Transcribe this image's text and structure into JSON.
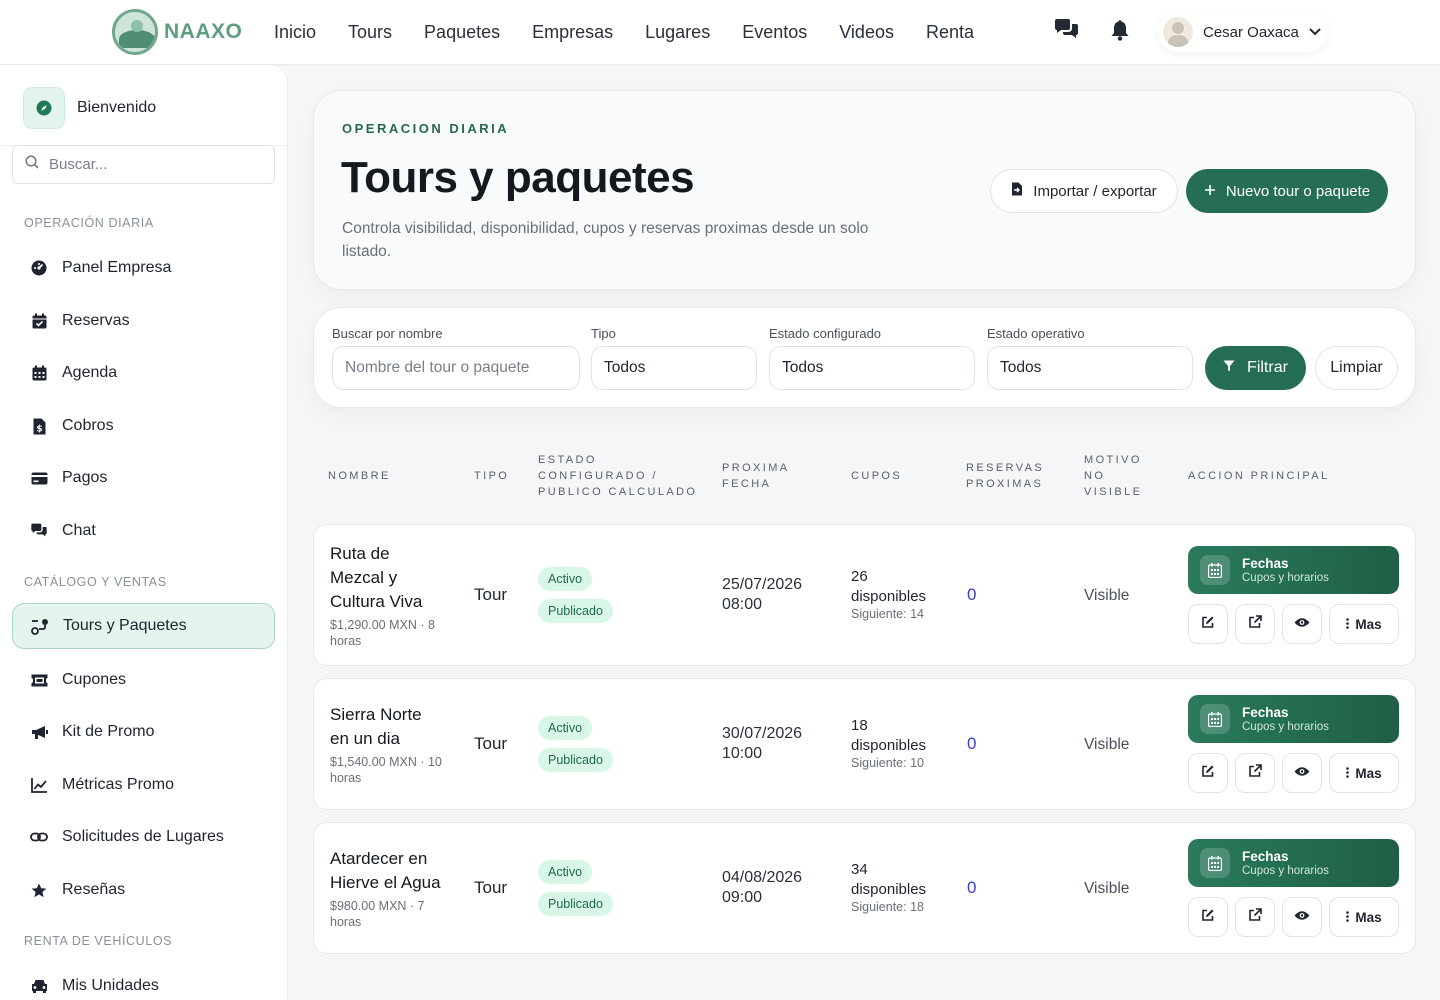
{
  "brand": {
    "name": "NAAXO"
  },
  "nav": [
    "Inicio",
    "Tours",
    "Paquetes",
    "Empresas",
    "Lugares",
    "Eventos",
    "Videos",
    "Renta"
  ],
  "user": {
    "name": "Cesar Oaxaca"
  },
  "sidebar": {
    "welcome": "Bienvenido",
    "search_placeholder": "Buscar...",
    "sections": [
      "OPERACIÓN DIARIA",
      "CATÁLOGO Y VENTAS",
      "RENTA DE VEHÍCULOS"
    ],
    "items": [
      {
        "label": "Panel Empresa",
        "icon": "dashboard-icon"
      },
      {
        "label": "Reservas",
        "icon": "calendar-check-icon"
      },
      {
        "label": "Agenda",
        "icon": "calendar-icon"
      },
      {
        "label": "Cobros",
        "icon": "invoice-dollar-icon"
      },
      {
        "label": "Pagos",
        "icon": "credit-card-icon"
      },
      {
        "label": "Chat",
        "icon": "chat-icon"
      },
      {
        "label": "Tours y Paquetes",
        "icon": "route-icon",
        "active": true
      },
      {
        "label": "Cupones",
        "icon": "ticket-icon"
      },
      {
        "label": "Kit de Promo",
        "icon": "megaphone-icon"
      },
      {
        "label": "Métricas Promo",
        "icon": "line-chart-icon"
      },
      {
        "label": "Solicitudes de Lugares",
        "icon": "link-icon"
      },
      {
        "label": "Reseñas",
        "icon": "star-icon"
      },
      {
        "label": "Mis Unidades",
        "icon": "car-icon"
      }
    ]
  },
  "hero": {
    "eyebrow": "OPERACION DIARIA",
    "title": "Tours y paquetes",
    "description": "Controla visibilidad, disponibilidad, cupos y reservas proximas desde un solo listado.",
    "import_label": "Importar / exportar",
    "new_label": "Nuevo tour o paquete"
  },
  "filters": {
    "name_label": "Buscar por nombre",
    "name_placeholder": "Nombre del tour o paquete",
    "type_label": "Tipo",
    "type_value": "Todos",
    "config_label": "Estado configurado",
    "config_value": "Todos",
    "op_label": "Estado operativo",
    "op_value": "Todos",
    "filter_label": "Filtrar",
    "clear_label": "Limpiar"
  },
  "table": {
    "headers": {
      "nombre": "NOMBRE",
      "tipo": "TIPO",
      "estado_1": "ESTADO",
      "estado_2": "CONFIGURADO /",
      "estado_3": "PUBLICO CALCULADO",
      "fecha_1": "PROXIMA",
      "fecha_2": "FECHA",
      "cupos": "CUPOS",
      "reservas_1": "RESERVAS",
      "reservas_2": "PROXIMAS",
      "motivo_1": "MOTIVO",
      "motivo_2": "NO",
      "motivo_3": "VISIBLE",
      "accion": "ACCION PRINCIPAL"
    },
    "rows": [
      {
        "name_lines": [
          "Ruta de",
          "Mezcal y",
          "Cultura Viva"
        ],
        "meta_lines": [
          "$1,290.00 MXN · 8",
          "horas"
        ],
        "type": "Tour",
        "status": "Activo",
        "public": "Publicado",
        "date": "25/07/2026",
        "time": "08:00",
        "cupos": "26",
        "cupos_label": "disponibles",
        "next": "Siguiente: 14",
        "reservas": "0",
        "visible": "Visible",
        "fechas": "Fechas",
        "fechas_sub": "Cupos y horarios",
        "more": "Mas"
      },
      {
        "name_lines": [
          "Sierra Norte",
          "en un dia"
        ],
        "meta_lines": [
          "$1,540.00 MXN · 10",
          "horas"
        ],
        "type": "Tour",
        "status": "Activo",
        "public": "Publicado",
        "date": "30/07/2026",
        "time": "10:00",
        "cupos": "18",
        "cupos_label": "disponibles",
        "next": "Siguiente: 10",
        "reservas": "0",
        "visible": "Visible",
        "fechas": "Fechas",
        "fechas_sub": "Cupos y horarios",
        "more": "Mas"
      },
      {
        "name_lines": [
          "Atardecer en",
          "Hierve el Agua"
        ],
        "meta_lines": [
          "$980.00 MXN · 7",
          "horas"
        ],
        "type": "Tour",
        "status": "Activo",
        "public": "Publicado",
        "date": "04/08/2026",
        "time": "09:00",
        "cupos": "34",
        "cupos_label": "disponibles",
        "next": "Siguiente: 18",
        "reservas": "0",
        "visible": "Visible",
        "fechas": "Fechas",
        "fechas_sub": "Cupos y horarios",
        "more": "Mas"
      }
    ]
  },
  "colors": {
    "primary": "#256e53",
    "accent_badge": "#d9f6e6",
    "reservas_link": "#3b3ad1"
  }
}
